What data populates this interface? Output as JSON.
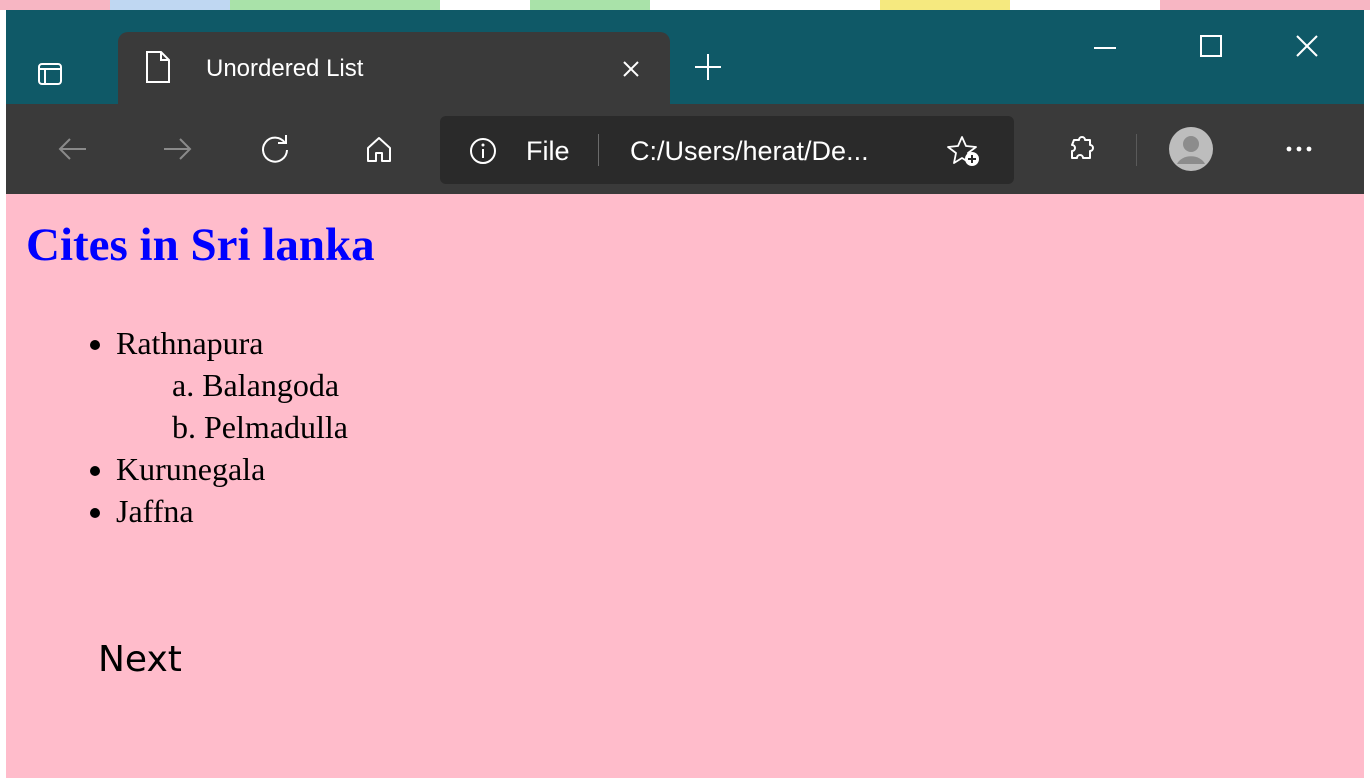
{
  "colors": {
    "titlebar": "#0F5967",
    "tab_active": "#3A3A3A",
    "toolbar": "#3A3A3A",
    "address_bar": "#2A2A2A",
    "page_background": "#FFBCCB",
    "heading": "#0000FF"
  },
  "browser": {
    "tab": {
      "title": "Unordered List",
      "page_icon": "page-icon",
      "close_icon": "close-icon"
    },
    "new_tab_icon": "plus-icon",
    "window_controls": [
      "minimize-icon",
      "maximize-icon",
      "close-icon"
    ],
    "toolbar": {
      "back_icon": "arrow-left-icon",
      "forward_icon": "arrow-right-icon",
      "refresh_icon": "refresh-icon",
      "home_icon": "home-icon",
      "extensions_icon": "extensions-icon",
      "profile_icon": "avatar-icon",
      "menu_icon": "more-icon"
    },
    "address": {
      "site_info_icon": "info-icon",
      "site_label": "File",
      "url": "C:/Users/herat/De...",
      "favorite_icon": "add-favorite-icon"
    }
  },
  "page": {
    "heading": "Cites in Sri lanka",
    "cities": [
      {
        "name": "Rathnapura",
        "sub": [
          "a. Balangoda",
          "b. Pelmadulla"
        ]
      },
      {
        "name": "Kurunegala"
      },
      {
        "name": "Jaffna"
      }
    ],
    "next_label": "Next"
  }
}
